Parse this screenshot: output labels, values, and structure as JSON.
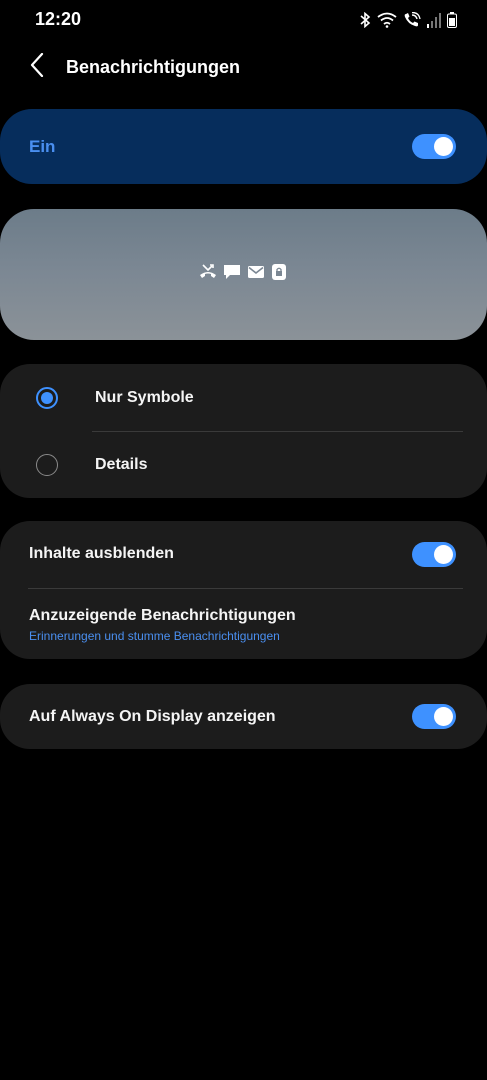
{
  "status_bar": {
    "time": "12:20",
    "icons": [
      "bluetooth-icon",
      "wifi-icon",
      "wifi-calling-icon",
      "signal-icon",
      "battery-icon"
    ]
  },
  "header": {
    "back_icon": "chevron-left-icon",
    "title": "Benachrichtigungen"
  },
  "master": {
    "label": "Ein",
    "enabled": true,
    "accent": "#4a8ff0",
    "background": "#062d5c"
  },
  "preview": {
    "icons": [
      "missed-call-icon",
      "message-icon",
      "email-icon",
      "lock-notification-icon"
    ]
  },
  "style_options": [
    {
      "label": "Nur Symbole",
      "selected": true
    },
    {
      "label": "Details",
      "selected": false
    }
  ],
  "content_settings": {
    "hide_content": {
      "label": "Inhalte ausblenden",
      "enabled": true
    },
    "notifications_to_show": {
      "label": "Anzuzeigende Benachrichtigungen",
      "sub": "Erinnerungen und stumme Benachrichtigungen"
    }
  },
  "aod": {
    "label": "Auf Always On Display anzeigen",
    "enabled": true
  },
  "colors": {
    "toggle_on": "#3e91ff",
    "card_bg": "#1c1c1c",
    "page_bg": "#000000"
  }
}
